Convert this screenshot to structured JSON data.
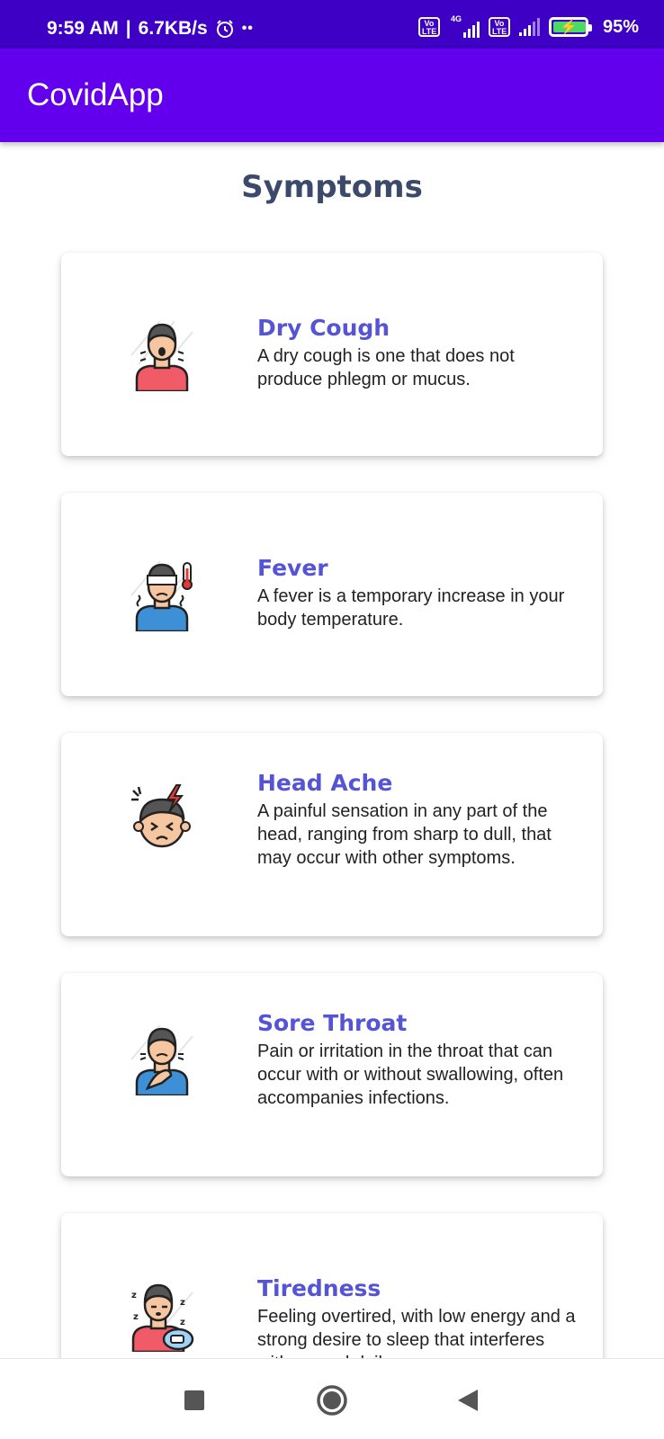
{
  "status_bar": {
    "time": "9:59 AM",
    "separator": "|",
    "speed": "6.7KB/s",
    "alarm_icon": "alarm-icon",
    "more_dots": "••",
    "network_label": "4G",
    "volte_1": "Vo\nLTE",
    "volte_2": "Vo\nLTE",
    "battery_percent": "95%"
  },
  "app_bar": {
    "title": "CovidApp",
    "color": "#6200EE"
  },
  "page": {
    "title": "Symptoms"
  },
  "symptoms": [
    {
      "title": "Dry Cough",
      "description": "A dry cough is one that does not produce phlegm or mucus.",
      "icon": "dry-cough-icon"
    },
    {
      "title": "Fever",
      "description": "A fever is a temporary increase in your body temperature.",
      "icon": "fever-icon"
    },
    {
      "title": "Head Ache",
      "description": "A painful sensation in any part of the head, ranging from sharp to dull, that may occur with other symptoms.",
      "icon": "headache-icon"
    },
    {
      "title": "Sore Throat",
      "description": "Pain or irritation in the throat that can occur with or without swallowing, often accompanies infections.",
      "icon": "sore-throat-icon"
    },
    {
      "title": "Tiredness",
      "description": "Feeling overtired, with low energy and a strong desire to sleep that interferes with normal daily",
      "icon": "tiredness-icon"
    }
  ],
  "nav": {
    "recents_icon": "recents-square-icon",
    "home_icon": "home-circle-icon",
    "back_icon": "back-triangle-icon"
  }
}
